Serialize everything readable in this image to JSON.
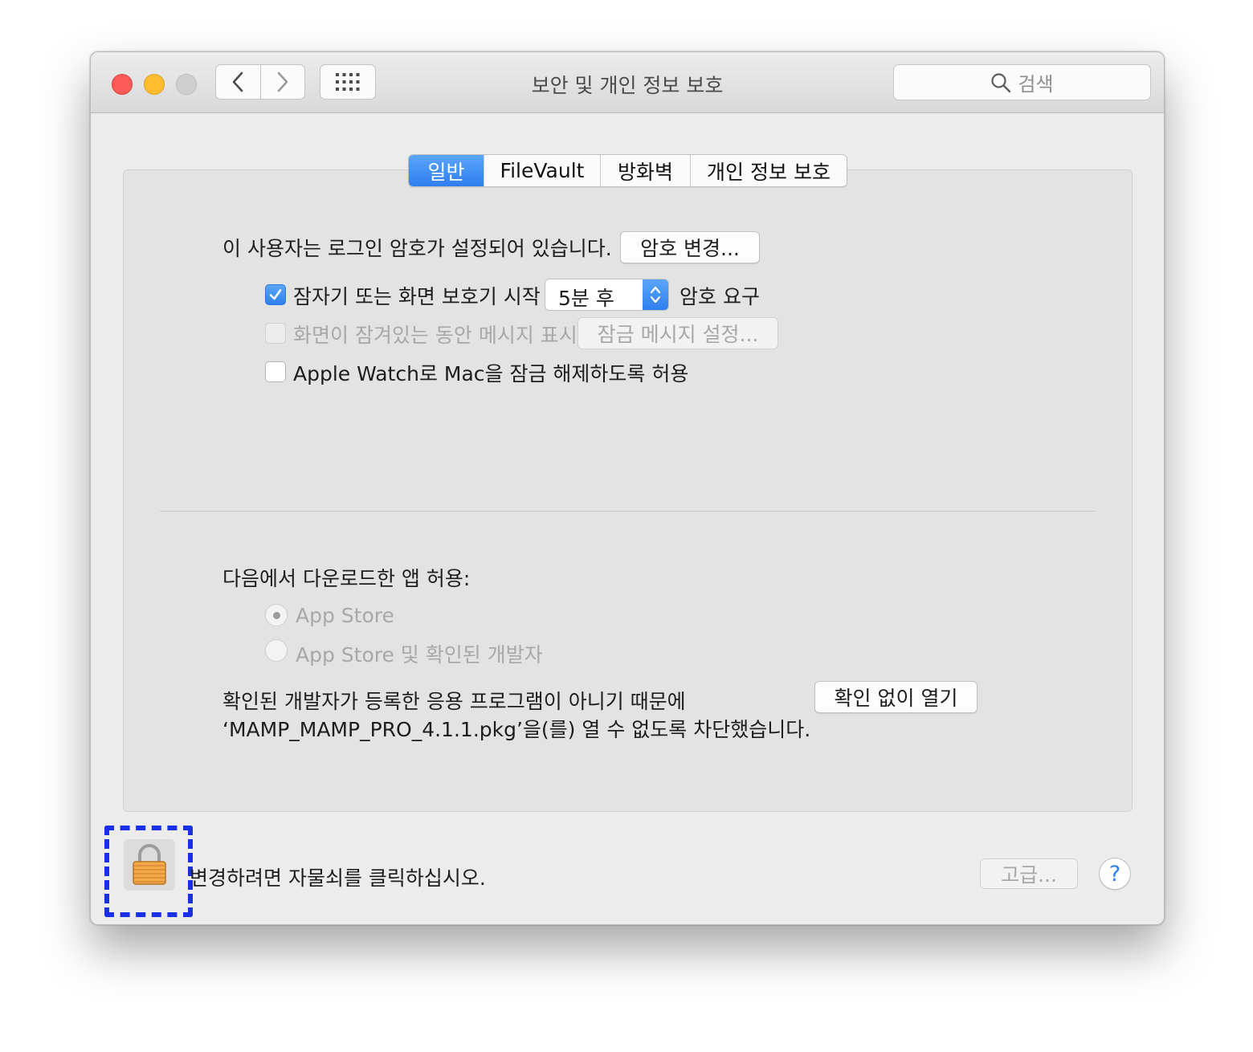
{
  "window": {
    "title": "보안 및 개인 정보 보호",
    "search_placeholder": "검색"
  },
  "tabs": [
    {
      "label": "일반",
      "active": true
    },
    {
      "label": "FileVault",
      "active": false
    },
    {
      "label": "방화벽",
      "active": false
    },
    {
      "label": "개인 정보 보호",
      "active": false
    }
  ],
  "general": {
    "login_password_text": "이 사용자는 로그인 암호가 설정되어 있습니다.",
    "change_password_button": "암호 변경...",
    "require_password": {
      "checked": true,
      "label": "잠자기 또는 화면 보호기 시작",
      "popup_value": "5분 후",
      "suffix": "암호 요구"
    },
    "show_message": {
      "checked": false,
      "enabled": false,
      "label": "화면이 잠겨있는 동안 메시지 표시",
      "button": "잠금 메시지 설정..."
    },
    "apple_watch": {
      "checked": false,
      "label": "Apple Watch로 Mac을 잠금 해제하도록 허용"
    }
  },
  "downloads": {
    "heading": "다음에서 다운로드한 앱 허용:",
    "options": [
      {
        "label": "App Store",
        "selected": true
      },
      {
        "label": "App Store 및 확인된 개발자",
        "selected": false
      }
    ],
    "blocked_line1": "확인된 개발자가 등록한 응용 프로그램이 아니기 때문에",
    "blocked_line2": "‘MAMP_MAMP_PRO_4.1.1.pkg’을(를) 열 수 없도록 차단했습니다.",
    "open_anyway_button": "확인 없이 열기"
  },
  "footer": {
    "lock_text": "변경하려면 자물쇠를 클릭하십시오.",
    "advanced_button": "고급...",
    "help_label": "?"
  },
  "colors": {
    "accent": "#2f7fef",
    "highlight": "#1a2fe8"
  }
}
